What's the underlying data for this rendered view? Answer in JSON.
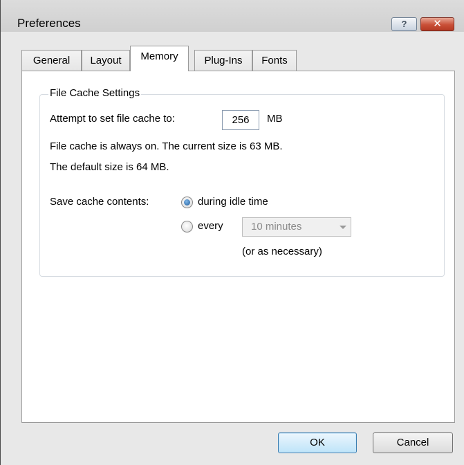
{
  "window": {
    "title": "Preferences",
    "help_button": "?",
    "close_button": "✕"
  },
  "tabs": [
    {
      "label": "General"
    },
    {
      "label": "Layout"
    },
    {
      "label": "Memory"
    },
    {
      "label": "Plug-Ins"
    },
    {
      "label": "Fonts"
    }
  ],
  "active_tab": "Memory",
  "file_cache": {
    "group_title": "File Cache Settings",
    "attempt_label": "Attempt to set file cache to:",
    "cache_value": "256",
    "cache_unit": "MB",
    "current_size_text": "File cache is always on.  The current size is 63 MB.",
    "default_size_text": "The default size is 64 MB.",
    "save_label": "Save cache contents:",
    "option_idle": "during idle time",
    "option_every": "every",
    "interval_value": "10 minutes",
    "as_necessary": "(or as necessary)",
    "selected_option": "during idle time"
  },
  "footer": {
    "ok_label": "OK",
    "cancel_label": "Cancel"
  }
}
